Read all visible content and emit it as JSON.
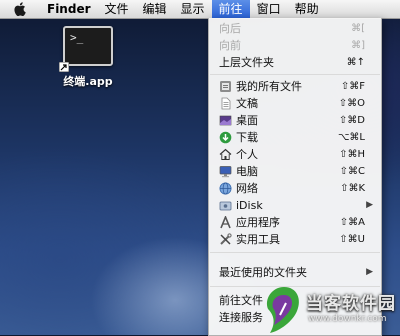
{
  "menubar": {
    "items": [
      {
        "label": "Finder"
      },
      {
        "label": "文件"
      },
      {
        "label": "编辑"
      },
      {
        "label": "显示"
      },
      {
        "label": "前往"
      },
      {
        "label": "窗口"
      },
      {
        "label": "帮助"
      }
    ]
  },
  "desktop": {
    "terminal_icon_glyph": ">_",
    "terminal_label": "终端.app"
  },
  "go_menu": {
    "items": [
      {
        "label": "向后",
        "shortcut": "⌘[",
        "icon": null,
        "enabled": false
      },
      {
        "label": "向前",
        "shortcut": "⌘]",
        "icon": null,
        "enabled": false
      },
      {
        "label": "上层文件夹",
        "shortcut": "⌘↑",
        "icon": null,
        "enabled": true
      },
      {
        "label": "我的所有文件",
        "shortcut": "⇧⌘F",
        "icon": "all-files-icon",
        "enabled": true
      },
      {
        "label": "文稿",
        "shortcut": "⇧⌘O",
        "icon": "documents-icon",
        "enabled": true
      },
      {
        "label": "桌面",
        "shortcut": "⇧⌘D",
        "icon": "desktop-icon",
        "enabled": true
      },
      {
        "label": "下载",
        "shortcut": "⌥⌘L",
        "icon": "downloads-icon",
        "enabled": true
      },
      {
        "label": "个人",
        "shortcut": "⇧⌘H",
        "icon": "home-icon",
        "enabled": true
      },
      {
        "label": "电脑",
        "shortcut": "⇧⌘C",
        "icon": "computer-icon",
        "enabled": true
      },
      {
        "label": "网络",
        "shortcut": "⇧⌘K",
        "icon": "network-icon",
        "enabled": true
      },
      {
        "label": "iDisk",
        "shortcut": "▶",
        "icon": "idisk-icon",
        "enabled": true
      },
      {
        "label": "应用程序",
        "shortcut": "⇧⌘A",
        "icon": "applications-icon",
        "enabled": true
      },
      {
        "label": "实用工具",
        "shortcut": "⇧⌘U",
        "icon": "utilities-icon",
        "enabled": true
      },
      {
        "label": "最近使用的文件夹",
        "shortcut": "▶",
        "icon": null,
        "enabled": true
      },
      {
        "label": "前往文件",
        "shortcut": "",
        "icon": null,
        "enabled": true
      },
      {
        "label": "连接服务",
        "shortcut": "",
        "icon": null,
        "enabled": true
      }
    ]
  },
  "watermark": {
    "title": "当客软件园",
    "url": "www.downkr.com"
  },
  "colors": {
    "menu_highlight": "#2b62d6",
    "menu_disabled": "#a8a8a8",
    "watermark_green": "#3aa63a",
    "watermark_purple": "#7a3aa0"
  }
}
